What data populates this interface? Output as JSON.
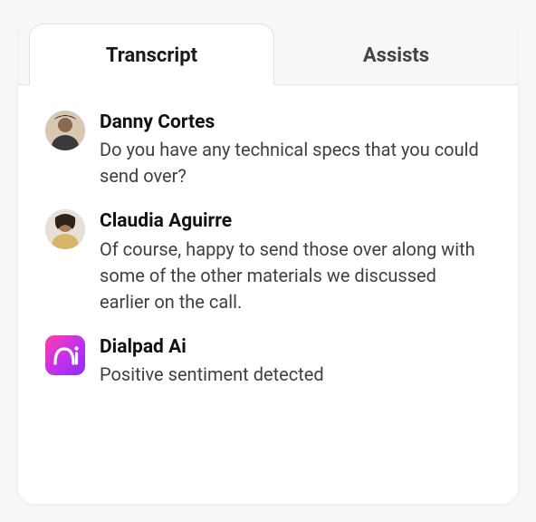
{
  "tabs": {
    "transcript": {
      "label": "Transcript",
      "active": true
    },
    "assists": {
      "label": "Assists",
      "active": false
    }
  },
  "transcript": [
    {
      "type": "user",
      "name": "Danny Cortes",
      "text": "Do you have any technical specs that you could send over?"
    },
    {
      "type": "user",
      "name": "Claudia Aguirre",
      "text": "Of course, happy to send those over along with some of the other materials we discussed earlier on the call."
    },
    {
      "type": "ai",
      "name": "Dialpad Ai",
      "text": "Positive sentiment detected"
    }
  ]
}
